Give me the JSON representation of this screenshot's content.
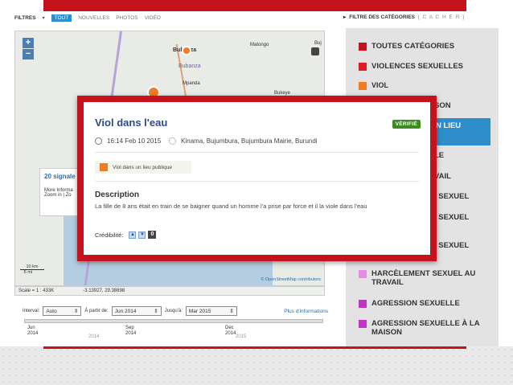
{
  "filters": {
    "label": "FILTRES",
    "tabs": [
      {
        "label": "TOUT",
        "active": true
      },
      {
        "label": "NOUVELLES",
        "active": false
      },
      {
        "label": "PHOTOS",
        "active": false
      },
      {
        "label": "VIDÉO",
        "active": false
      }
    ]
  },
  "category_header": {
    "title": "FILTRE DES CATÉGORIES",
    "hide": "[ C A C H E R ]"
  },
  "map": {
    "cities": [
      "Bubanza",
      "Bubanza",
      "Mpanda",
      "Matongo",
      "Bukeye",
      "Buj"
    ],
    "side_popup": {
      "title": "20 signale",
      "line1": "More Informa",
      "line2": "Zoom in | Zo"
    },
    "scale": {
      "km": "10 km",
      "mi": "5 mi"
    },
    "attribution": "© OpenStreetMap contributors",
    "status": {
      "scale": "Scale = 1 : 433K",
      "coords": "-3.13927, 29.38698"
    }
  },
  "time_controls": {
    "interval_label": "Interval:",
    "interval_value": "Auto",
    "from_label": "À partir de:",
    "from_value": "Jun 2014",
    "to_label": "Jusqu'à:",
    "to_value": "Mar 2015",
    "more_info": "Plus d'informations"
  },
  "timeline": {
    "ticks": [
      {
        "month": "Jun",
        "year": "2014"
      },
      {
        "month": "Sep",
        "year": "2014"
      },
      {
        "month": "Dec",
        "year": "2014"
      }
    ],
    "years": [
      "2014",
      "2015"
    ]
  },
  "categories": [
    {
      "label": "TOUTES CATÉGORIES",
      "color": "#c4131c"
    },
    {
      "label": "VIOLENCES SEXUELLES",
      "color": "#e01b22"
    },
    {
      "label": "VIOL",
      "color": "#f07b22"
    },
    {
      "label": "SON",
      "color": ""
    },
    {
      "label": "N LIEU",
      "color": "",
      "active": true
    },
    {
      "label": "LE",
      "color": ""
    },
    {
      "label": "VAIL",
      "color": ""
    },
    {
      "label": "NT SEXUEL",
      "color": ""
    },
    {
      "label": "NT SEXUEL",
      "color": ""
    },
    {
      "label": "NT SEXUEL",
      "color": ""
    },
    {
      "label": "HARCÈLEMENT SEXUEL AU TRAVAIL",
      "color": "#e58ce3"
    },
    {
      "label": "AGRESSION SEXUELLE",
      "color": "#c036c4"
    },
    {
      "label": "AGRESSION SEXUELLE À LA MAISON",
      "color": "#c036c4"
    }
  ],
  "report": {
    "title": "Viol dans l'eau",
    "verified": "VÉRIFIÉ",
    "time": "16:14 Feb 10 2015",
    "location": "Kinama, Bujumbura, Bujumbura Mairie, Burundi",
    "category": "Viol dans un lieu publique",
    "category_color": "#f07b22",
    "description_heading": "Description",
    "description": "La fille de 8 ans était en train de se baigner quand un homme l'a prise par force et il la viole dans l'eau",
    "credibility_label": "Crédibilité:",
    "credibility_score": "0"
  }
}
